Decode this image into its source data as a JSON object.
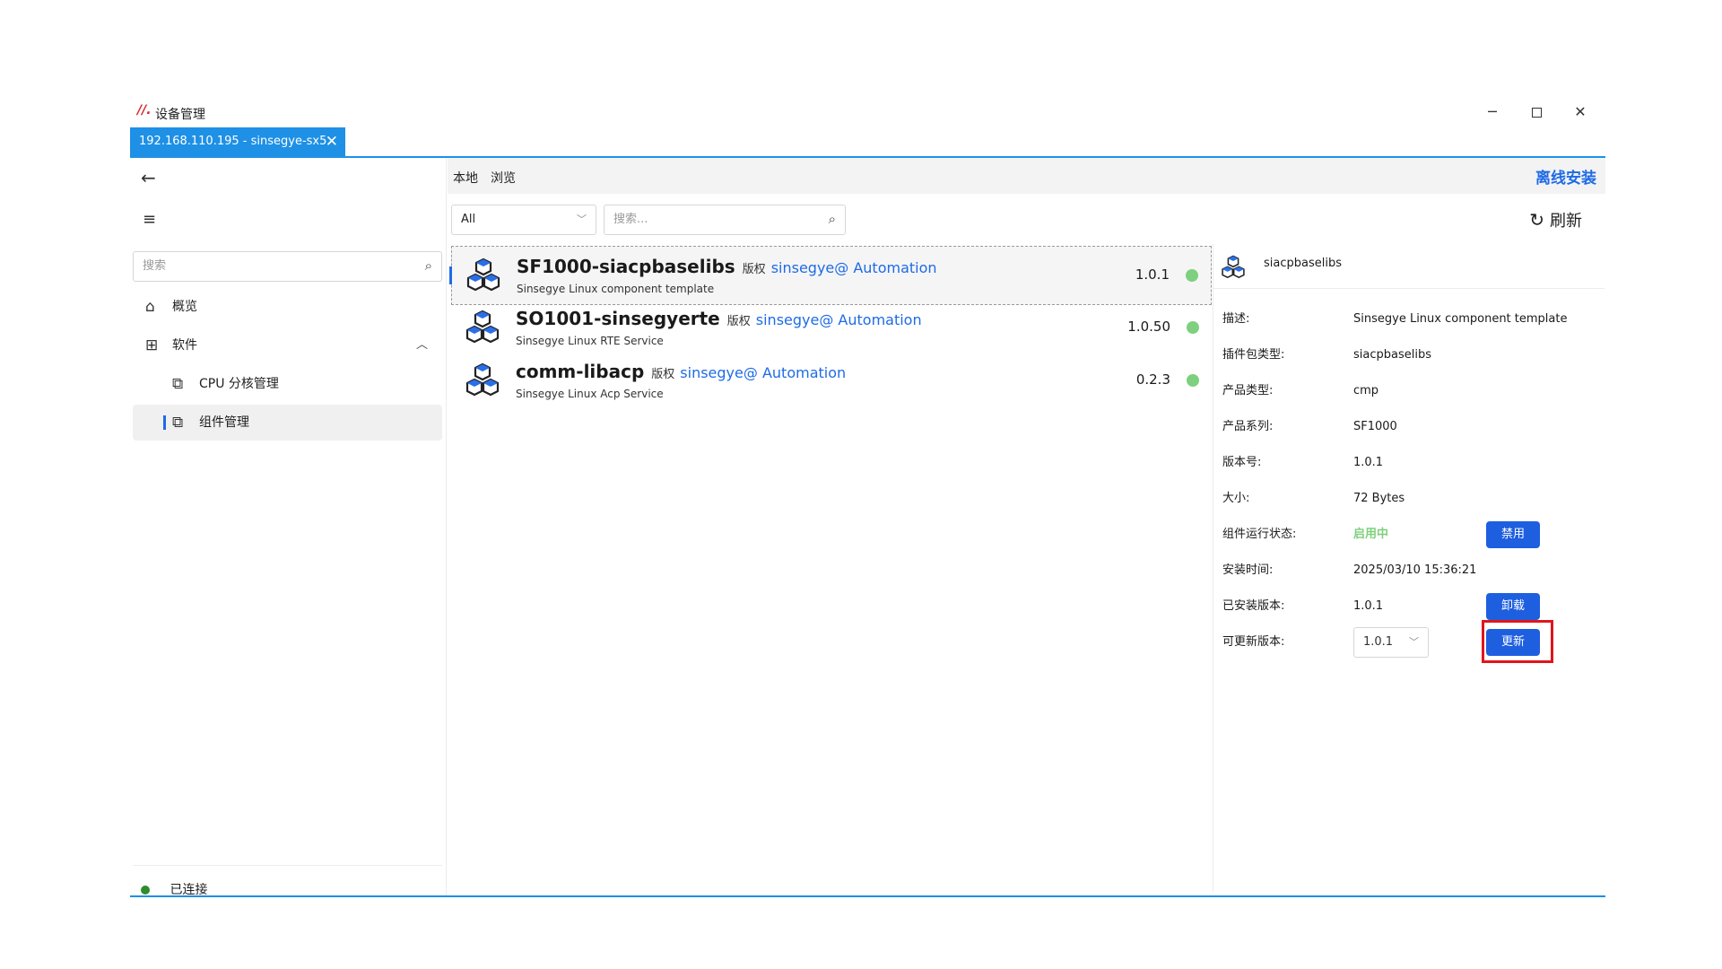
{
  "app": {
    "logo": "//.",
    "title": "设备管理"
  },
  "window_controls": {
    "minimize": "─",
    "close": "✕"
  },
  "tab": {
    "label": "192.168.110.195 - sinsegye-sx5",
    "close": "✕"
  },
  "sidebar": {
    "search_placeholder": "搜索",
    "items": [
      {
        "label": "概览",
        "icon": "home-icon"
      },
      {
        "label": "软件",
        "icon": "grid-icon"
      },
      {
        "label": "CPU 分核管理",
        "icon": "puzzle-icon"
      },
      {
        "label": "组件管理",
        "icon": "puzzle-icon"
      }
    ],
    "status": "已连接"
  },
  "main": {
    "tabs": [
      "本地",
      "浏览"
    ],
    "offline_install": "离线安装",
    "filter": {
      "selected": "All"
    },
    "search_placeholder": "搜索...",
    "refresh": "刷新"
  },
  "packages": [
    {
      "name": "SF1000-siacpbaselibs",
      "copyright": "版权",
      "author": "sinsegye@ Automation",
      "desc": "Sinsegye Linux component template",
      "version": "1.0.1",
      "status_color": "#7ed07e"
    },
    {
      "name": "SO1001-sinsegyerte",
      "copyright": "版权",
      "author": "sinsegye@ Automation",
      "desc": "Sinsegye Linux RTE Service",
      "version": "1.0.50",
      "status_color": "#7ed07e"
    },
    {
      "name": "comm-libacp",
      "copyright": "版权",
      "author": "sinsegye@ Automation",
      "desc": "Sinsegye Linux Acp Service",
      "version": "0.2.3",
      "status_color": "#7ed07e"
    }
  ],
  "details": {
    "name": "siacpbaselibs",
    "rows": [
      {
        "key": "描述:",
        "value": "Sinsegye Linux component template"
      },
      {
        "key": "插件包类型:",
        "value": "siacpbaselibs"
      },
      {
        "key": "产品类型:",
        "value": "cmp"
      },
      {
        "key": "产品系列:",
        "value": "SF1000"
      },
      {
        "key": "版本号:",
        "value": "1.0.1"
      },
      {
        "key": "大小:",
        "value": "72 Bytes"
      },
      {
        "key": "组件运行状态:",
        "value": "启用中"
      },
      {
        "key": "安装时间:",
        "value": "2025/03/10 15:36:21"
      },
      {
        "key": "已安装版本:",
        "value": "1.0.1"
      },
      {
        "key": "可更新版本:",
        "value": "1.0.1"
      }
    ],
    "disable_button": "禁用",
    "uninstall_button": "卸载",
    "update_button": "更新"
  },
  "colors": {
    "accent": "#1e90e6",
    "primary_button": "#1e5fe0",
    "status_ok": "#7ed07e",
    "highlight": "#e0151c"
  }
}
